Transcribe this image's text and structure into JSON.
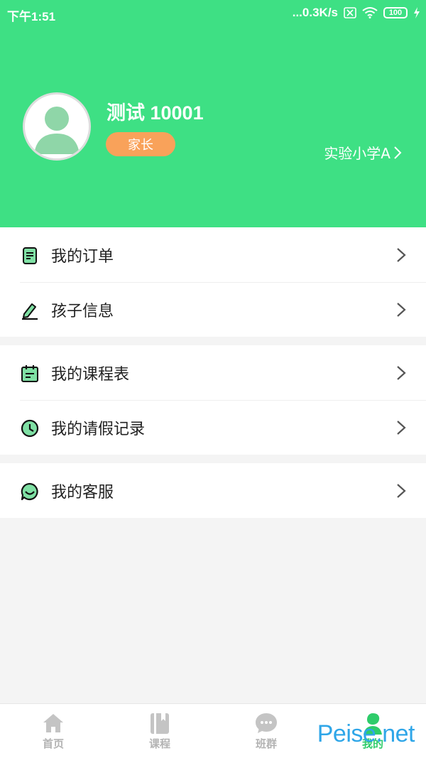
{
  "status_bar": {
    "time": "下午1:51",
    "speed": "...0.3K/s",
    "battery": "100"
  },
  "profile": {
    "name": "测试 10001",
    "role": "家长",
    "school": "实验小学A"
  },
  "menu": {
    "groups": [
      [
        {
          "label": "我的订单",
          "icon": "order-icon"
        },
        {
          "label": "孩子信息",
          "icon": "edit-icon"
        }
      ],
      [
        {
          "label": "我的课程表",
          "icon": "calendar-icon"
        },
        {
          "label": "我的请假记录",
          "icon": "clock-icon"
        }
      ],
      [
        {
          "label": "我的客服",
          "icon": "service-icon"
        }
      ]
    ]
  },
  "bottom_nav": {
    "items": [
      {
        "label": "首页",
        "icon": "home-icon",
        "active": false
      },
      {
        "label": "课程",
        "icon": "book-icon",
        "active": false
      },
      {
        "label": "班群",
        "icon": "chat-icon",
        "active": false
      },
      {
        "label": "我的",
        "icon": "person-icon",
        "active": true
      }
    ]
  },
  "watermark": "Peise.net",
  "colors": {
    "header_green": "#3ee084",
    "badge_orange": "#f9a25a",
    "active_green": "#2ecc6a",
    "inactive_gray": "#b3b3b3"
  }
}
